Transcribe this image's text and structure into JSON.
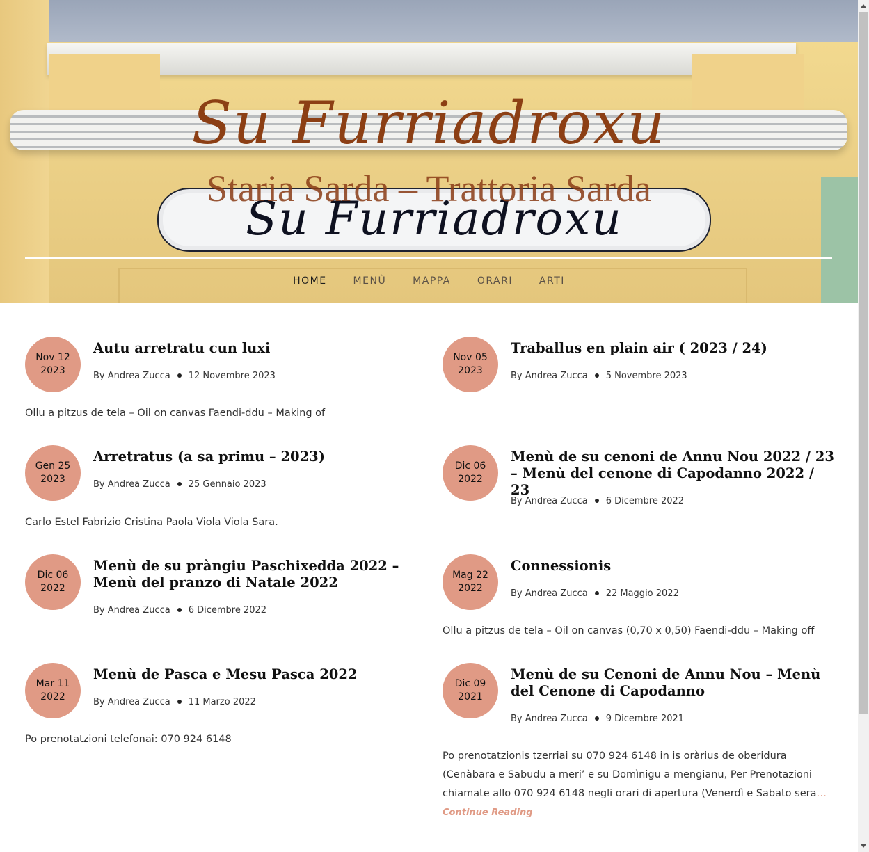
{
  "site": {
    "title": "Su Furriadroxu",
    "tagline": "Staria Sarda – Trattoria Sarda",
    "sign_text": "Su Furriadroxu"
  },
  "nav": {
    "items": [
      {
        "label": "HOME",
        "active": true
      },
      {
        "label": "MENÙ",
        "active": false
      },
      {
        "label": "MAPPA",
        "active": false
      },
      {
        "label": "ORARI",
        "active": false
      },
      {
        "label": "ARTI",
        "active": false
      }
    ]
  },
  "colors": {
    "accent": "#e09a85",
    "title": "#8c3f14"
  },
  "posts": [
    {
      "date_top": "Nov 12",
      "date_year": "2023",
      "title": "Autu arretratu cun luxi",
      "author": "By Andrea Zucca",
      "date": "12 Novembre 2023",
      "excerpt": "Ollu a pitzus de tela – Oil on canvas Faendi-ddu – Making of"
    },
    {
      "date_top": "Nov 05",
      "date_year": "2023",
      "title": "Traballus en plain air ( 2023 / 24)",
      "author": "By Andrea Zucca",
      "date": "5 Novembre 2023",
      "excerpt": ""
    },
    {
      "date_top": "Gen 25",
      "date_year": "2023",
      "title": "Arretratus (a sa primu – 2023)",
      "author": "By Andrea Zucca",
      "date": "25 Gennaio 2023",
      "excerpt": "Carlo Estel Fabrizio Cristina Paola Viola Viola Sara."
    },
    {
      "date_top": "Dic 06",
      "date_year": "2022",
      "title": "Menù de su cenoni de Annu Nou 2022 / 23 – Menù del cenone di Capodanno 2022 / 23",
      "author": "By Andrea Zucca",
      "date": "6 Dicembre 2022",
      "excerpt": ""
    },
    {
      "date_top": "Dic 06",
      "date_year": "2022",
      "title": "Menù de su pràngiu Paschixedda 2022 – Menù del pranzo di Natale 2022",
      "author": "By Andrea Zucca",
      "date": "6 Dicembre 2022",
      "excerpt": ""
    },
    {
      "date_top": "Mag 22",
      "date_year": "2022",
      "title": "Connessionis",
      "author": "By Andrea Zucca",
      "date": "22 Maggio 2022",
      "excerpt": "Ollu a pitzus de tela – Oil on canvas  (0,70 x 0,50) Faendi-ddu – Making off"
    },
    {
      "date_top": "Mar 11",
      "date_year": "2022",
      "title": "Menù de Pasca e Mesu Pasca 2022",
      "author": "By Andrea Zucca",
      "date": "11 Marzo 2022",
      "excerpt": "Po prenotatzioni telefonai: 070 924 6148"
    },
    {
      "date_top": "Dic 09",
      "date_year": "2021",
      "title": "Menù de su Cenoni de Annu Nou – Menù del Cenone di Capodanno",
      "author": "By Andrea Zucca",
      "date": "9 Dicembre 2021",
      "excerpt": "Po prenotatzionis tzerriai su 070 924 6148 in is oràrius de oberidura (Cenàbara e Sabudu a meri’ e su Domìnigu a mengianu, Per Prenotazioni chiamate allo 070 924 6148 negli orari di apertura (Venerdì e Sabato sera",
      "ellipsis": "…",
      "more": "Continue Reading"
    }
  ]
}
